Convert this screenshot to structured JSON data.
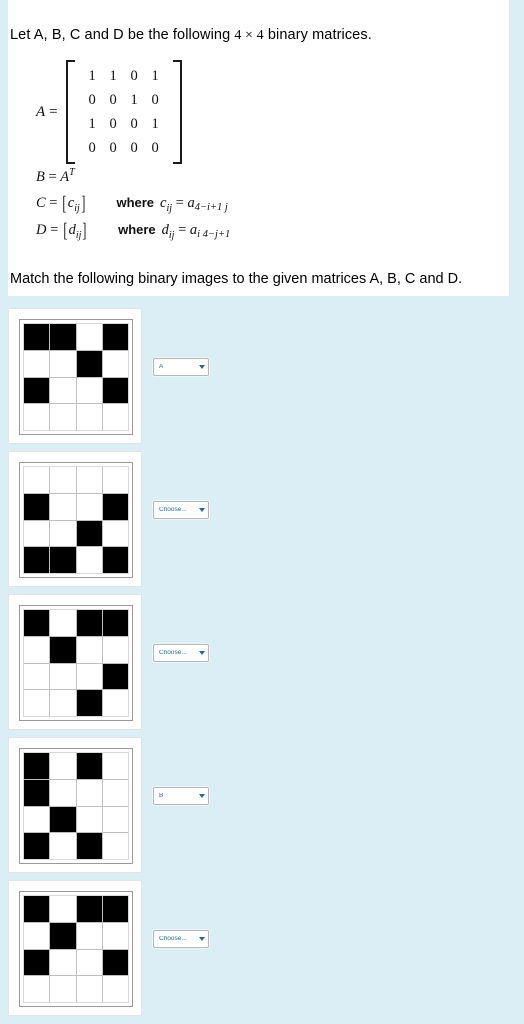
{
  "question": {
    "intro_prefix": "Let A, B, C and D be the following ",
    "intro_dim": "4 × 4",
    "intro_suffix": "  binary matrices.",
    "matrix_label": "A",
    "equals": "=",
    "matrix_rows": [
      [
        "1",
        "1",
        "0",
        "1"
      ],
      [
        "0",
        "0",
        "1",
        "0"
      ],
      [
        "1",
        "0",
        "0",
        "1"
      ],
      [
        "0",
        "0",
        "0",
        "0"
      ]
    ],
    "def_b": {
      "lhs": "B",
      "equals": "=",
      "rhs": "A",
      "sup": "T"
    },
    "def_c": {
      "lhs": "C",
      "equals": "=",
      "bracket_open": "[",
      "bracket_body": "c",
      "bracket_sub": "ij",
      "bracket_close": "]",
      "where": "where",
      "rel_lhs": "c",
      "rel_lhs_sub": "ij",
      "rel_eq": "=",
      "rel_rhs": "a",
      "rel_rhs_sub": "4−i+1 j"
    },
    "def_d": {
      "lhs": "D",
      "equals": "=",
      "bracket_open": "[",
      "bracket_body": "d",
      "bracket_sub": "ij",
      "bracket_close": "]",
      "where": "where",
      "rel_lhs": "d",
      "rel_lhs_sub": "ij",
      "rel_eq": "=",
      "rel_rhs": "a",
      "rel_rhs_sub": "i 4−j+1"
    },
    "match_instruction": "Match the following binary images to the given matrices A, B, C and D."
  },
  "colors": {
    "page_background": "#dceef5",
    "panel_background": "#ffffff",
    "cell_on": "#000000",
    "cell_off": "#ffffff",
    "dropdown_text": "#2b6b87",
    "grid_line": "#bfbfbf"
  },
  "items": [
    {
      "id": "image-1",
      "grid": [
        [
          1,
          1,
          0,
          1
        ],
        [
          0,
          0,
          1,
          0
        ],
        [
          1,
          0,
          0,
          1
        ],
        [
          0,
          0,
          0,
          0
        ]
      ],
      "dropdown": {
        "selected": "A",
        "placeholder": "Choose...",
        "options": [
          "Choose...",
          "A",
          "B",
          "C",
          "D"
        ]
      }
    },
    {
      "id": "image-2",
      "grid": [
        [
          0,
          0,
          0,
          0
        ],
        [
          1,
          0,
          0,
          1
        ],
        [
          0,
          0,
          1,
          0
        ],
        [
          1,
          1,
          0,
          1
        ]
      ],
      "dropdown": {
        "selected": "Choose...",
        "placeholder": "Choose...",
        "options": [
          "Choose...",
          "A",
          "B",
          "C",
          "D"
        ]
      }
    },
    {
      "id": "image-3",
      "grid": [
        [
          1,
          0,
          1,
          1
        ],
        [
          0,
          1,
          0,
          0
        ],
        [
          0,
          0,
          0,
          1
        ],
        [
          0,
          0,
          1,
          0
        ]
      ],
      "dropdown": {
        "selected": "Choose...",
        "placeholder": "Choose...",
        "options": [
          "Choose...",
          "A",
          "B",
          "C",
          "D"
        ]
      }
    },
    {
      "id": "image-4",
      "grid": [
        [
          1,
          0,
          1,
          0
        ],
        [
          1,
          0,
          0,
          0
        ],
        [
          0,
          1,
          0,
          0
        ],
        [
          1,
          0,
          1,
          0
        ]
      ],
      "dropdown": {
        "selected": "B",
        "placeholder": "Choose...",
        "options": [
          "Choose...",
          "A",
          "B",
          "C",
          "D"
        ]
      }
    },
    {
      "id": "image-5",
      "grid": [
        [
          1,
          0,
          1,
          1
        ],
        [
          0,
          1,
          0,
          0
        ],
        [
          1,
          0,
          0,
          1
        ],
        [
          0,
          0,
          0,
          0
        ]
      ],
      "dropdown": {
        "selected": "Choose...",
        "placeholder": "Choose...",
        "options": [
          "Choose...",
          "A",
          "B",
          "C",
          "D"
        ]
      }
    }
  ]
}
